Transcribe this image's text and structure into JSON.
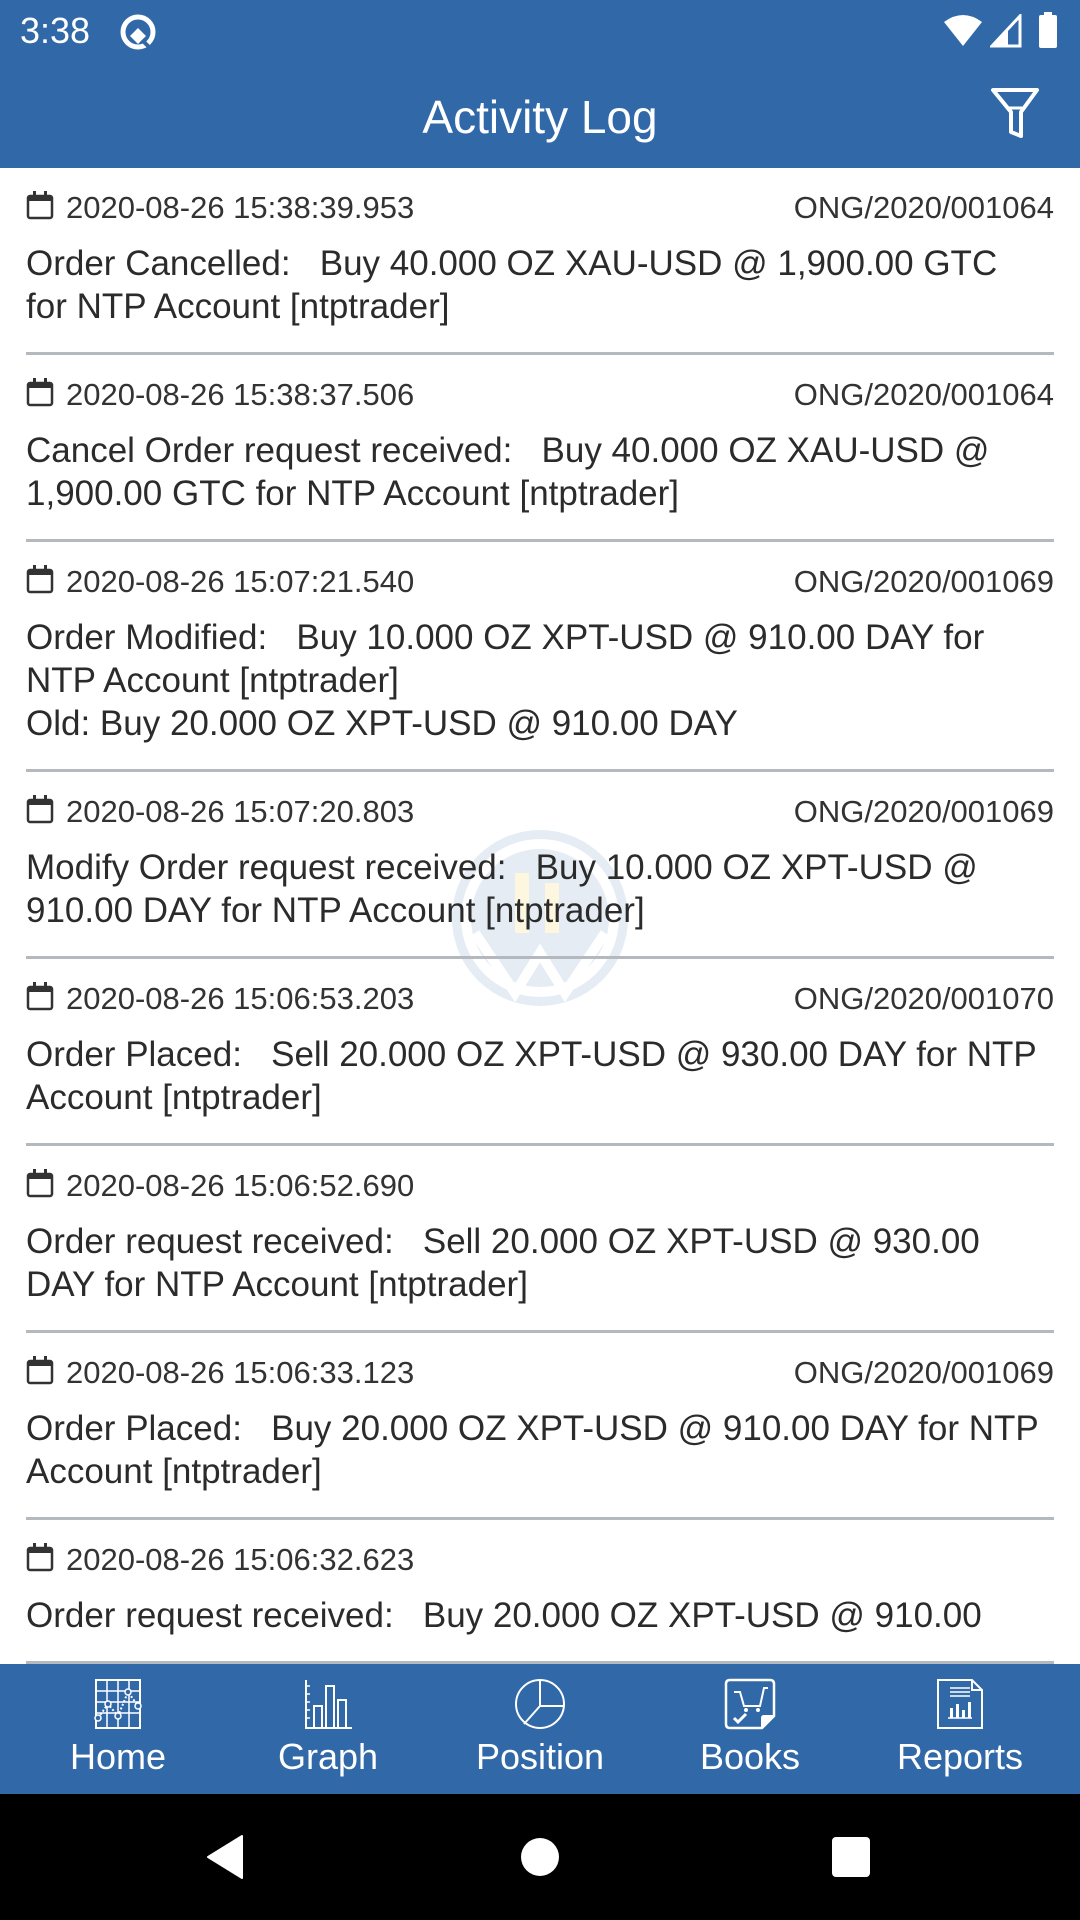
{
  "status_bar": {
    "time": "3:38",
    "icons": [
      "q-notification-icon",
      "wifi-icon",
      "signal-icon",
      "battery-icon"
    ]
  },
  "app_bar": {
    "title": "Activity Log",
    "filter_icon": "filter-icon"
  },
  "entries": [
    {
      "timestamp": "2020-08-26 15:38:39.953",
      "reference": "ONG/2020/001064",
      "message": "Order Cancelled:   Buy 40.000 OZ XAU-USD @ 1,900.00 GTC\nfor NTP Account [ntptrader]"
    },
    {
      "timestamp": "2020-08-26 15:38:37.506",
      "reference": "ONG/2020/001064",
      "message": "Cancel Order request received:   Buy 40.000 OZ XAU-USD @\n1,900.00 GTC for NTP Account [ntptrader]"
    },
    {
      "timestamp": "2020-08-26 15:07:21.540",
      "reference": "ONG/2020/001069",
      "message": "Order Modified:   Buy 10.000 OZ XPT-USD @ 910.00 DAY for\nNTP Account [ntptrader]\nOld: Buy 20.000 OZ XPT-USD @ 910.00 DAY"
    },
    {
      "timestamp": "2020-08-26 15:07:20.803",
      "reference": "ONG/2020/001069",
      "message": "Modify Order request received:   Buy 10.000 OZ XPT-USD @\n910.00 DAY for NTP Account [ntptrader]"
    },
    {
      "timestamp": "2020-08-26 15:06:53.203",
      "reference": "ONG/2020/001070",
      "message": "Order Placed:   Sell 20.000 OZ XPT-USD @ 930.00 DAY for NTP\nAccount [ntptrader]"
    },
    {
      "timestamp": "2020-08-26 15:06:52.690",
      "reference": "",
      "message": "Order request received:   Sell 20.000 OZ XPT-USD @ 930.00\nDAY for NTP Account [ntptrader]"
    },
    {
      "timestamp": "2020-08-26 15:06:33.123",
      "reference": "ONG/2020/001069",
      "message": "Order Placed:   Buy 20.000 OZ XPT-USD @ 910.00 DAY for NTP\nAccount [ntptrader]"
    },
    {
      "timestamp": "2020-08-26 15:06:32.623",
      "reference": "",
      "message": "Order request received:   Buy 20.000 OZ XPT-USD @ 910.00"
    }
  ],
  "bottom_nav": [
    {
      "label": "Home",
      "icon": "line-chart-grid-icon"
    },
    {
      "label": "Graph",
      "icon": "bar-chart-icon"
    },
    {
      "label": "Position",
      "icon": "pie-chart-icon"
    },
    {
      "label": "Books",
      "icon": "cart-check-icon"
    },
    {
      "label": "Reports",
      "icon": "report-document-icon"
    }
  ],
  "system_nav": [
    "back-icon",
    "home-icon",
    "recents-icon"
  ],
  "colors": {
    "primary": "#3168a8",
    "divider": "#b4b8bf",
    "text": "#2b2b2b"
  }
}
